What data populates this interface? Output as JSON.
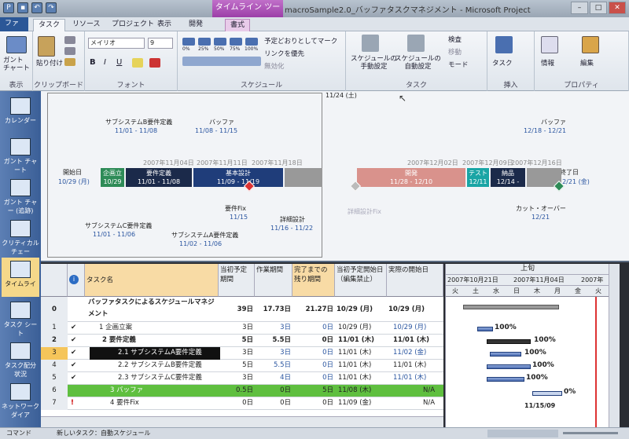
{
  "titlebar": {
    "context_tab": "タイムライン ツール",
    "title": "macroSample2.0_バッファタスクマネジメント - Microsoft Project"
  },
  "tabs": [
    "ファイル",
    "タスク",
    "リソース",
    "プロジェクト",
    "表示",
    "開発",
    "書式"
  ],
  "ribbon": {
    "gantt_btn": "ガント\nチャート",
    "paste_btn": "貼り付け",
    "font_name": "メイリオ",
    "font_size": "9",
    "pct_labels": [
      "0%",
      "25%",
      "50%",
      "75%",
      "100%"
    ],
    "mark_on_track": "予定どおりとしてマーク",
    "respect_links": "リンクを優先",
    "inactivate": "無効化",
    "manual_schedule": "スケジュールの\n手動設定",
    "auto_schedule": "スケジュールの\n自動設定",
    "inspect": "検査",
    "move": "移動",
    "mode": "モード",
    "task_btn": "タスク",
    "info_btn": "情報",
    "edit_btn": "編集",
    "groups": {
      "view": "表示",
      "clipboard": "クリップボード",
      "font": "フォント",
      "schedule": "スケジュール",
      "tasks": "タスク",
      "insert": "挿入",
      "properties": "プロパティ"
    }
  },
  "viewbar": [
    "カレンダー",
    "ガント チャート",
    "ガント チャー (追跡)",
    "クリティカル チェー",
    "タイムライ",
    "タスク シート",
    "タスク配分 状況",
    "ネットワーク ダイア"
  ],
  "timeline": {
    "top_date": "11/24 (土)",
    "start_label": "開始日",
    "start_date": "10/29 (月)",
    "end_label": "終了日",
    "end_date": "12/21 (金)",
    "scale_dates": [
      "2007年11月04日",
      "2007年11月11日",
      "2007年11月18日",
      "2007年12月02日",
      "2007年12月09日",
      "2007年12月16日"
    ],
    "bars": [
      {
        "name": "企画立",
        "dates": "10/29",
        "color": "#2e8b57"
      },
      {
        "name": "要件定義",
        "dates": "11/01 - 11/08",
        "color": "#1b2a4a"
      },
      {
        "name": "基本設計",
        "dates": "11/09 - 11/19",
        "color": "#1f3d7a"
      },
      {
        "name": "開発",
        "dates": "11/28 - 12/10",
        "color": "#d9928c"
      },
      {
        "name": "テスト",
        "dates": "12/11",
        "color": "#1aa5a5"
      },
      {
        "name": "納品",
        "dates": "12/14 -",
        "color": "#1b2a4a"
      }
    ],
    "callouts": [
      {
        "name": "サブシステムB要件定義",
        "dates": "11/01 - 11/08"
      },
      {
        "name": "バッファ",
        "dates": "11/08 - 11/15"
      },
      {
        "name": "バッファ",
        "dates": "12/18 - 12/21"
      },
      {
        "name": "要件Fix",
        "dates": "11/15"
      },
      {
        "name": "詳細設計",
        "dates": "11/16 - 11/22"
      },
      {
        "name": "サブシステムC要件定義",
        "dates": "11/01 - 11/06"
      },
      {
        "name": "サブシステムA要件定義",
        "dates": "11/02 - 11/06"
      },
      {
        "name": "カット・オーバー",
        "dates": "12/21"
      },
      {
        "name": "詳細設計Fix",
        "dates": ""
      }
    ]
  },
  "table": {
    "headers": [
      "タスク名",
      "当初予定期間",
      "作業期間",
      "完了までの残り期間",
      "当初予定開始日（編集禁止）",
      "実際の開始日"
    ],
    "rows": [
      {
        "id": "0",
        "check": "",
        "name": "バッファタスクによるスケジュールマネジメント",
        "d1": "39日",
        "d2": "17.73日",
        "d3": "21.27日",
        "start": "10/29 (月)",
        "actual": "10/29 (月)",
        "bold": true
      },
      {
        "id": "1",
        "check": "✔",
        "name": "1 企画立案",
        "d1": "3日",
        "d2": "3日",
        "d3": "0日",
        "start": "10/29 (月)",
        "actual": "10/29 (月)"
      },
      {
        "id": "2",
        "check": "✔",
        "name": "2 要件定義",
        "d1": "5日",
        "d2": "5.5日",
        "d3": "0日",
        "start": "11/01 (木)",
        "actual": "11/01 (木)",
        "bold": true
      },
      {
        "id": "3",
        "check": "✔",
        "name": "2.1 サブシステムA要件定義",
        "d1": "3日",
        "d2": "3日",
        "d3": "0日",
        "start": "11/01 (木)",
        "actual": "11/02 (金)"
      },
      {
        "id": "4",
        "check": "✔",
        "name": "2.2 サブシステムB要件定義",
        "d1": "5日",
        "d2": "5.5日",
        "d3": "0日",
        "start": "11/01 (木)",
        "actual": "11/01 (木)"
      },
      {
        "id": "5",
        "check": "✔",
        "name": "2.3 サブシステムC要件定義",
        "d1": "3日",
        "d2": "4日",
        "d3": "0日",
        "start": "11/01 (木)",
        "actual": "11/01 (木)"
      },
      {
        "id": "6",
        "check": "",
        "name": "3 バッファ",
        "d1": "0.5日",
        "d2": "0日",
        "d3": "5日",
        "start": "11/08 (木)",
        "actual": "N/A"
      },
      {
        "id": "7",
        "check": "!",
        "name": "4 要件Fix",
        "d1": "0日",
        "d2": "0日",
        "d3": "0日",
        "start": "11/09 (金)",
        "actual": "N/A"
      }
    ]
  },
  "gantt": {
    "period": "上旬",
    "weeks": [
      "2007年10月21日",
      "2007年11月04日",
      "2007年"
    ],
    "days": [
      "火",
      "土",
      "水",
      "日",
      "木",
      "月",
      "金",
      "火"
    ],
    "progress": [
      "100%",
      "100%",
      "100%",
      "100%",
      "100%",
      "0%"
    ],
    "milestone": "11/15/09"
  },
  "status": {
    "mode": "コマンド",
    "new_task": "新しいタスク：自動スケジュール"
  }
}
